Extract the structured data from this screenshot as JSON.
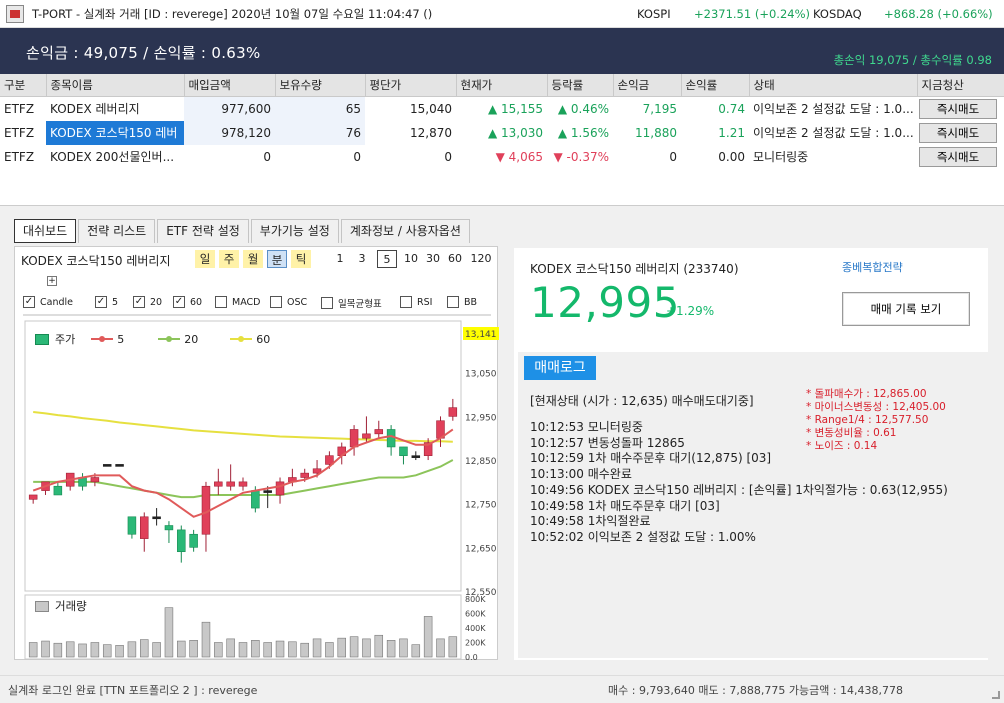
{
  "window": {
    "title": "T-PORT - 실계좌 거래 [ID : reverege] 2020년 10월 07일 수요일 11:04:47 ()",
    "kospi_label": "KOSPI",
    "kospi_value": "+2371.51 (+0.24%)",
    "kosdaq_label": "KOSDAQ",
    "kosdaq_value": "+868.28 (+0.66%)"
  },
  "summary": {
    "main": "손익금 : 49,075  /  손익률 : 0.63%",
    "total": "총손익 19,075 / 총수익률 0.98"
  },
  "positions": {
    "headers": [
      "구분",
      "종목이름",
      "매입금액",
      "보유수량",
      "평단가",
      "현재가",
      "등락률",
      "손익금",
      "손익률",
      "상태",
      "지금청산"
    ],
    "rows": [
      {
        "type": "ETFZ",
        "name": "KODEX 레버리지",
        "buy": "977,600",
        "qty": "65",
        "avg": "15,040",
        "cur": "15,155",
        "rate": "0.46%",
        "pl": "7,195",
        "plr": "0.74",
        "status": "이익보존 2 설정값 도달 : 1.0...",
        "btn": "즉시매도"
      },
      {
        "type": "ETFZ",
        "name": "KODEX 코스닥150 레버",
        "buy": "978,120",
        "qty": "76",
        "avg": "12,870",
        "cur": "13,030",
        "rate": "1.56%",
        "pl": "11,880",
        "plr": "1.21",
        "status": "이익보존 2 설정값 도달 : 1.0...",
        "btn": "즉시매도"
      },
      {
        "type": "ETFZ",
        "name": "KODEX 200선물인버...",
        "buy": "0",
        "qty": "0",
        "avg": "0",
        "cur": "4,065",
        "rate": "-0.37%",
        "pl": "0",
        "plr": "0.00",
        "status": "모니터링중",
        "btn": "즉시매도"
      }
    ]
  },
  "tabs": [
    "대쉬보드",
    "전략 리스트",
    "ETF 전략 설정",
    "부가기능 설정",
    "계좌정보 / 사용자옵션"
  ],
  "chart": {
    "title": "KODEX 코스닥150 레버리지",
    "periods": [
      "일",
      "주",
      "월",
      "분",
      "틱"
    ],
    "minutes": [
      "1",
      "3",
      "5",
      "10",
      "30",
      "60",
      "120"
    ],
    "plus": "+",
    "checks": [
      {
        "label": "Candle",
        "checked": true
      },
      {
        "label": "5",
        "checked": true
      },
      {
        "label": "20",
        "checked": true
      },
      {
        "label": "60",
        "checked": true
      },
      {
        "label": "MACD",
        "checked": false
      },
      {
        "label": "OSC",
        "checked": false
      },
      {
        "label": "일목균형표",
        "checked": false
      },
      {
        "label": "RSI",
        "checked": false
      },
      {
        "label": "BB",
        "checked": false
      }
    ],
    "legend_price": "주가",
    "legend_ma5": "5",
    "legend_ma20": "20",
    "legend_ma60": "60",
    "volume_label": "거래량",
    "colors": {
      "up": "#e0405a",
      "down": "#2bb877",
      "ma5": "#e05a5a",
      "ma20": "#8cc45a",
      "ma60": "#e6e040"
    }
  },
  "chart_data": {
    "type": "candlestick",
    "title": "KODEX 코스닥150 레버리지",
    "y_ticks": [
      "13,141",
      "13,050",
      "12,950",
      "12,850",
      "12,750",
      "12,650",
      "12,550"
    ],
    "ylim": [
      12550,
      13141
    ],
    "last_price_label": "13,141",
    "volume_ticks": [
      "800K",
      "600K",
      "400K",
      "200K",
      "0.0"
    ],
    "volume_ylim": [
      0,
      800000
    ],
    "candles": [
      [
        12760,
        12770,
        12750,
        12765
      ],
      [
        12780,
        12800,
        12770,
        12790
      ],
      [
        12790,
        12770,
        12770,
        12800
      ],
      [
        12790,
        12820,
        12780,
        12810
      ],
      [
        12810,
        12790,
        12780,
        12820
      ],
      [
        12800,
        12810,
        12790,
        12820
      ],
      [
        12840,
        12840,
        12840,
        12840
      ],
      [
        12840,
        12840,
        12840,
        12840
      ],
      [
        12720,
        12680,
        12670,
        12720
      ],
      [
        12670,
        12720,
        12640,
        12730
      ],
      [
        12720,
        12720,
        12700,
        12740
      ],
      [
        12700,
        12690,
        12660,
        12710
      ],
      [
        12690,
        12640,
        12615,
        12700
      ],
      [
        12680,
        12650,
        12640,
        12690
      ],
      [
        12680,
        12790,
        12640,
        12800
      ],
      [
        12790,
        12800,
        12770,
        12830
      ],
      [
        12790,
        12800,
        12780,
        12840
      ],
      [
        12790,
        12800,
        12780,
        12810
      ],
      [
        12780,
        12740,
        12730,
        12790
      ],
      [
        12780,
        12780,
        12740,
        12790
      ],
      [
        12770,
        12800,
        12750,
        12810
      ],
      [
        12800,
        12810,
        12790,
        12830
      ],
      [
        12810,
        12820,
        12800,
        12830
      ],
      [
        12820,
        12830,
        12810,
        12850
      ],
      [
        12840,
        12860,
        12830,
        12870
      ],
      [
        12860,
        12880,
        12840,
        12890
      ],
      [
        12880,
        12920,
        12860,
        12930
      ],
      [
        12900,
        12910,
        12890,
        12950
      ],
      [
        12910,
        12920,
        12900,
        12940
      ],
      [
        12920,
        12880,
        12860,
        12930
      ],
      [
        12880,
        12860,
        12840,
        12880
      ],
      [
        12860,
        12860,
        12850,
        12870
      ],
      [
        12860,
        12890,
        12850,
        12900
      ],
      [
        12900,
        12940,
        12880,
        12950
      ],
      [
        12950,
        12970,
        12940,
        12990
      ]
    ],
    "ma5": [
      12780,
      12790,
      12800,
      12805,
      12810,
      12815,
      12815,
      12815,
      12790,
      12780,
      12775,
      12760,
      12740,
      12720,
      12730,
      12745,
      12760,
      12775,
      12780,
      12785,
      12790,
      12800,
      12805,
      12815,
      12835,
      12860,
      12880,
      12890,
      12900,
      12905,
      12895,
      12885,
      12885,
      12900,
      12920
    ],
    "ma20": [
      12800,
      12800,
      12800,
      12800,
      12800,
      12800,
      12795,
      12790,
      12785,
      12780,
      12775,
      12770,
      12765,
      12765,
      12770,
      12770,
      12770,
      12770,
      12770,
      12770,
      12770,
      12775,
      12780,
      12785,
      12790,
      12795,
      12800,
      12805,
      12810,
      12810,
      12810,
      12815,
      12825,
      12835,
      12850
    ],
    "ma60": [
      12960,
      12957,
      12953,
      12950,
      12946,
      12943,
      12940,
      12936,
      12933,
      12930,
      12927,
      12924,
      12921,
      12918,
      12916,
      12914,
      12912,
      12910,
      12908,
      12906,
      12904,
      12903,
      12902,
      12901,
      12900,
      12899,
      12898,
      12897,
      12896,
      12895,
      12894,
      12894,
      12893,
      12893,
      12892
    ],
    "volume": [
      200000,
      220000,
      190000,
      210000,
      180000,
      200000,
      170000,
      160000,
      210000,
      240000,
      200000,
      680000,
      220000,
      230000,
      480000,
      200000,
      250000,
      200000,
      230000,
      200000,
      220000,
      210000,
      190000,
      250000,
      200000,
      260000,
      280000,
      250000,
      300000,
      230000,
      250000,
      170000,
      560000,
      250000,
      280000
    ]
  },
  "info": {
    "name": "KODEX 코스닥150 레버리지 (233740)",
    "strategy": "종베복합전략",
    "price": "12,995",
    "change": "+1.29%",
    "history_btn": "매매 기록 보기"
  },
  "log": {
    "title": "매매로그",
    "status": "[현재상태 (시가 : 12,635) 매수매도대기중]",
    "lines": [
      "10:12:53 모니터링중",
      "10:12:57 변동성돌파 12865",
      "10:12:59 1차 매수주문후 대기(12,875) [03]",
      "10:13:00 매수완료",
      "10:49:56 KODEX 코스닥150 레버리지 : [손익률] 1차익절가능 : 0.63(12,955)",
      "10:49:58 1차 매도주문후 대기 [03]",
      "10:49:58 1차익절완료",
      "10:52:02 이익보존 2 설정값 도달 : 1.00%"
    ],
    "side": [
      "* 돌파매수가 : 12,865.00",
      "* 마이너스변동성 : 12,405.00",
      "* Range1/4 : 12,577.50",
      "* 변동성비율 : 0.61",
      "* 노이즈 : 0.14"
    ]
  },
  "statusbar": {
    "left": "실계좌 로그인 완료 [TTN 포트폴리오 2 ] : reverege",
    "right": "매수 : 9,793,640  매도 : 7,888,775  가능금액 : 14,438,778"
  }
}
